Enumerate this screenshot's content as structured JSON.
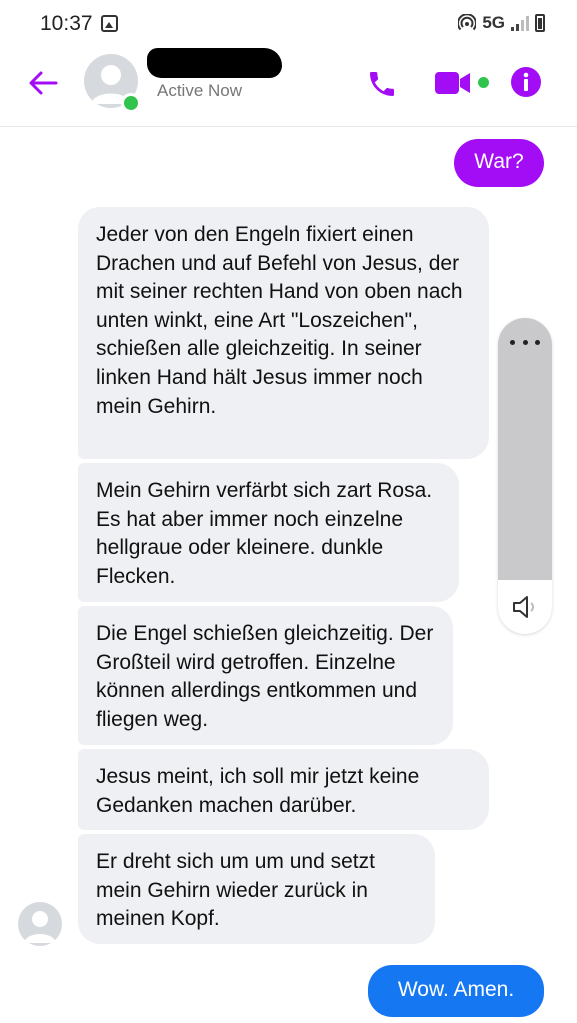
{
  "status_bar": {
    "time": "10:37",
    "network": "5G"
  },
  "header": {
    "presence": "Active Now",
    "accent_color": "#a30df5",
    "online_color": "#31c44c"
  },
  "messages": [
    {
      "direction": "outgoing",
      "text": "War?"
    },
    {
      "direction": "incoming",
      "text": "Jeder von den Engeln fixiert einen Drachen und auf Befehl von Jesus, der mit seiner rechten Hand von oben nach unten winkt, eine Art \"Loszeichen\", schießen alle gleichzeitig. In seiner linken Hand hält Jesus immer noch mein Gehirn."
    },
    {
      "direction": "incoming",
      "text": "Mein Gehirn verfärbt sich zart Rosa. Es hat aber immer noch einzelne hellgraue oder kleinere. dunkle Flecken."
    },
    {
      "direction": "incoming",
      "text": "Die Engel schießen gleichzeitig. Der Großteil wird getroffen. Einzelne können allerdings entkommen und fliegen weg."
    },
    {
      "direction": "incoming",
      "text": "Jesus meint, ich soll mir jetzt keine Gedanken machen darüber."
    },
    {
      "direction": "incoming",
      "text": "Er dreht sich um um und setzt mein Gehirn wieder zurück in meinen Kopf."
    },
    {
      "direction": "outgoing",
      "text": "Wow.  Amen."
    }
  ]
}
